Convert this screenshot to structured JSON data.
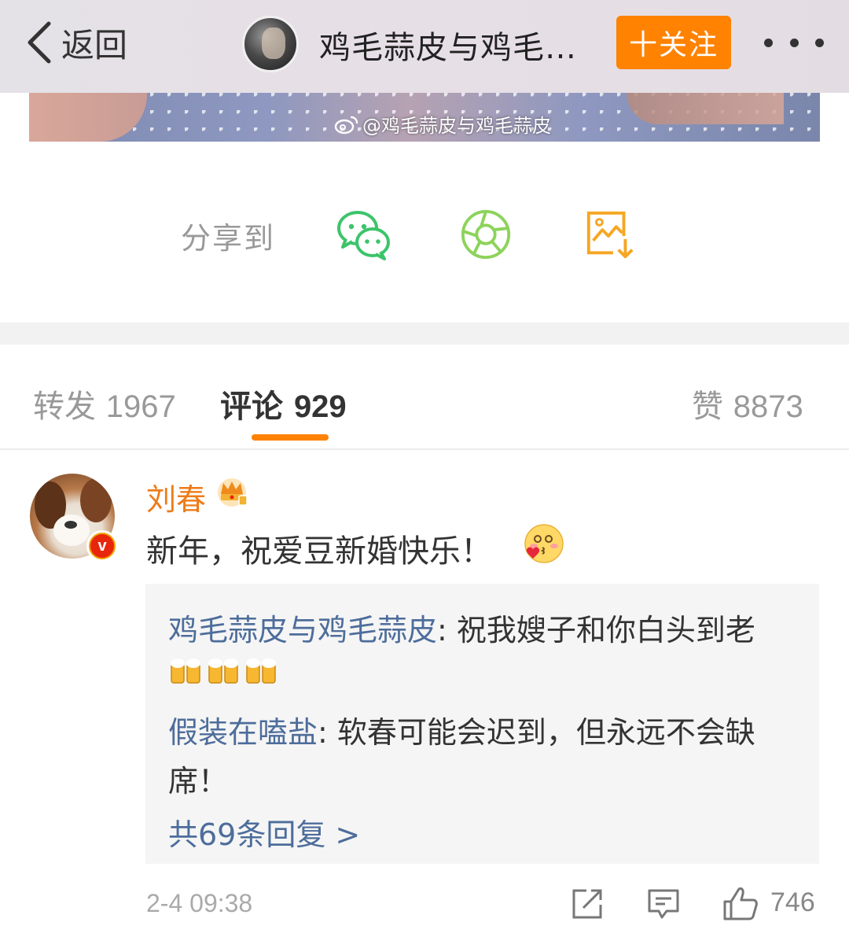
{
  "navbar": {
    "back_label": "返回",
    "title": "鸡毛蒜皮与鸡毛…",
    "follow_label": "十关注"
  },
  "photo": {
    "watermark": "@鸡毛蒜皮与鸡毛蒜皮"
  },
  "share": {
    "label": "分享到",
    "targets": [
      "wechat-icon",
      "moments-icon",
      "save-image-icon"
    ]
  },
  "tabs": [
    {
      "label": "转发",
      "count": "1967"
    },
    {
      "label": "评论",
      "count": "929",
      "active": true
    },
    {
      "label": "赞",
      "count": "8873"
    }
  ],
  "comment": {
    "author": "刘春",
    "text": "新年，祝爱豆新婚快乐！",
    "replies": [
      {
        "author": "鸡毛蒜皮与鸡毛蒜皮",
        "sep": ": ",
        "text": "祝我嫂子和你白头到老"
      },
      {
        "author": "假装在嗑盐",
        "sep": ": ",
        "text": "软春可能会迟到，但永远不会缺",
        "text2": "席！"
      }
    ],
    "more_replies": "共69条回复 >",
    "time": "2-4 09:38",
    "likes": "746"
  },
  "colors": {
    "accent": "#ff8200",
    "link": "#4d6d9b",
    "username": "#ee7b18"
  }
}
